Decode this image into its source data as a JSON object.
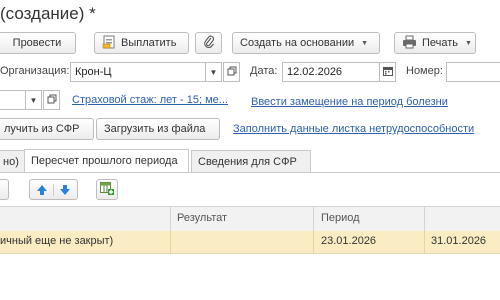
{
  "window": {
    "title": "(создание) *"
  },
  "toolbar": {
    "post_label": "Провести",
    "pay_label": "Выплатить",
    "create_based_label": "Создать на основании",
    "print_label": "Печать"
  },
  "header": {
    "org_label": "Организация:",
    "org_value": "Крон-Ц",
    "date_label": "Дата:",
    "date_value": "12.02.2026",
    "number_label": "Номер:",
    "number_value": ""
  },
  "links": {
    "insurance_label": "Страховой стаж: лет - 15; ме...",
    "replacement_label": "Ввести замещение на период болезни",
    "fill_sheet_label": "Заполнить данные листка нетрудоспособности"
  },
  "actions": {
    "get_sfr_label": "лучить из СФР",
    "load_file_label": "Загрузить из файла"
  },
  "tabs": [
    {
      "label": "но)"
    },
    {
      "label": "Пересчет прошлого периода",
      "active": true
    },
    {
      "label": "Сведения для СФР"
    }
  ],
  "table": {
    "columns": [
      "Результат",
      "Период"
    ],
    "rows": [
      {
        "description": "ичный еще не закрыт)",
        "result": "",
        "period_from": "23.01.2026",
        "period_to": "31.01.2026"
      }
    ]
  }
}
